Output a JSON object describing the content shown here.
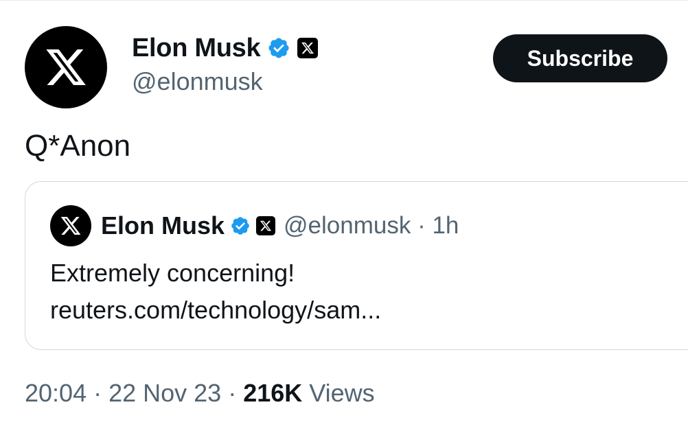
{
  "author": {
    "name": "Elon Musk",
    "handle": "@elonmusk",
    "avatar_icon": "x-logo-icon",
    "verified_icon": "verified-badge-icon",
    "affiliation_icon": "x-affiliate-badge-icon"
  },
  "subscribe_label": "Subscribe",
  "tweet_text": "Q*Anon",
  "quote": {
    "name": "Elon Musk",
    "handle": "@elonmusk",
    "separator": " · ",
    "time": "1h",
    "line1": "Extremely concerning!",
    "line2": "reuters.com/technology/sam..."
  },
  "footer": {
    "time": "20:04",
    "sep1": " · ",
    "date": "22 Nov 23",
    "sep2": " · ",
    "views_count": "216K",
    "views_label": " Views"
  },
  "colors": {
    "text_primary": "#0f1419",
    "text_secondary": "#536471",
    "verified_blue": "#1d9bf0",
    "border": "#cfd9de"
  }
}
